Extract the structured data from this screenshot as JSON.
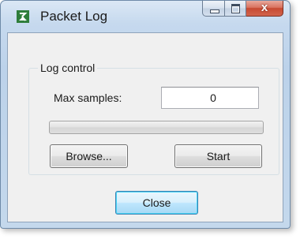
{
  "window": {
    "title": "Packet Log",
    "icon": "packet-log-app-icon",
    "caption_buttons": {
      "minimize_icon": "minimize-icon",
      "maximize_icon": "maximize-icon",
      "close_icon": "close-icon",
      "close_glyph": "x"
    }
  },
  "log_control": {
    "group_label": "Log control",
    "max_samples_label": "Max samples:",
    "max_samples_value": "0",
    "progress_fraction": 0.0,
    "browse_label": "Browse...",
    "start_label": "Start"
  },
  "footer": {
    "close_label": "Close"
  },
  "colors": {
    "accent_close": "#c74a32",
    "default_button_border": "#3c7fb1",
    "progress_fill": "#06b025"
  }
}
